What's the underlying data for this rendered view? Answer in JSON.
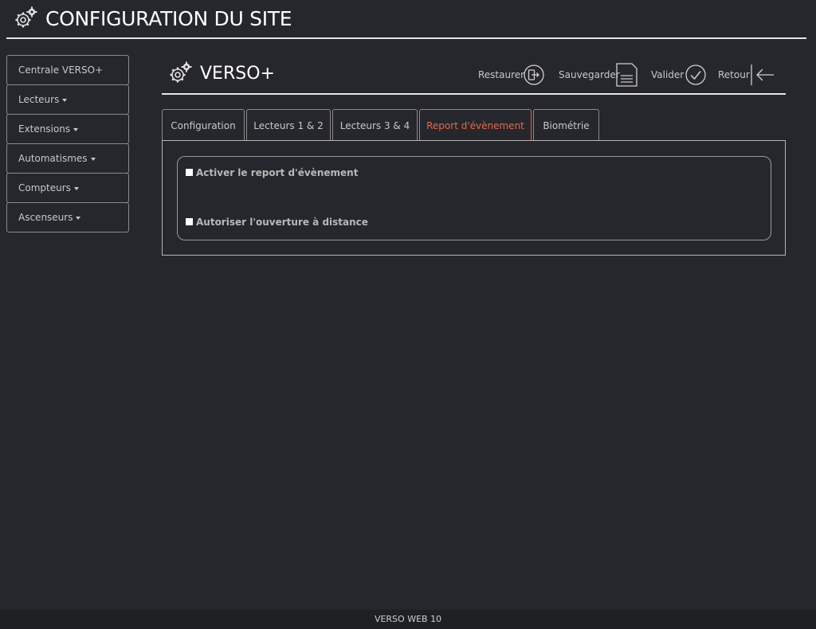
{
  "app": {
    "title": "CONFIGURATION DU SITE",
    "footer": "VERSO WEB 10"
  },
  "sidebar": {
    "items": [
      {
        "label": "Centrale VERSO+",
        "dropdown": false
      },
      {
        "label": "Lecteurs",
        "dropdown": true
      },
      {
        "label": "Extensions",
        "dropdown": true
      },
      {
        "label": "Automatismes",
        "dropdown": true
      },
      {
        "label": "Compteurs",
        "dropdown": true
      },
      {
        "label": "Ascenseurs",
        "dropdown": true
      }
    ]
  },
  "panel": {
    "title": "VERSO+",
    "actions": {
      "restore": {
        "label": "Restaurer",
        "icon": "restore-icon"
      },
      "save": {
        "label": "Sauvegarder",
        "icon": "save-icon"
      },
      "validate": {
        "label": "Valider",
        "icon": "check-icon"
      },
      "back": {
        "label": "Retour",
        "icon": "arrow-left-icon"
      }
    }
  },
  "tabs": [
    {
      "label": "Configuration",
      "active": false
    },
    {
      "label": "Lecteurs 1 & 2",
      "active": false
    },
    {
      "label": "Lecteurs 3 & 4",
      "active": false
    },
    {
      "label": "Report d'évènement",
      "active": true
    },
    {
      "label": "Biométrie",
      "active": false
    }
  ],
  "form": {
    "enable_event_report": {
      "label": "Activer le report d'évènement",
      "checked": false
    },
    "allow_remote_opening": {
      "label": "Autoriser l'ouverture à distance",
      "checked": false
    }
  },
  "colors": {
    "background": "#26272c",
    "accent": "#e8664a",
    "border": "#8a8a8a",
    "text": "#c8c8c8"
  }
}
